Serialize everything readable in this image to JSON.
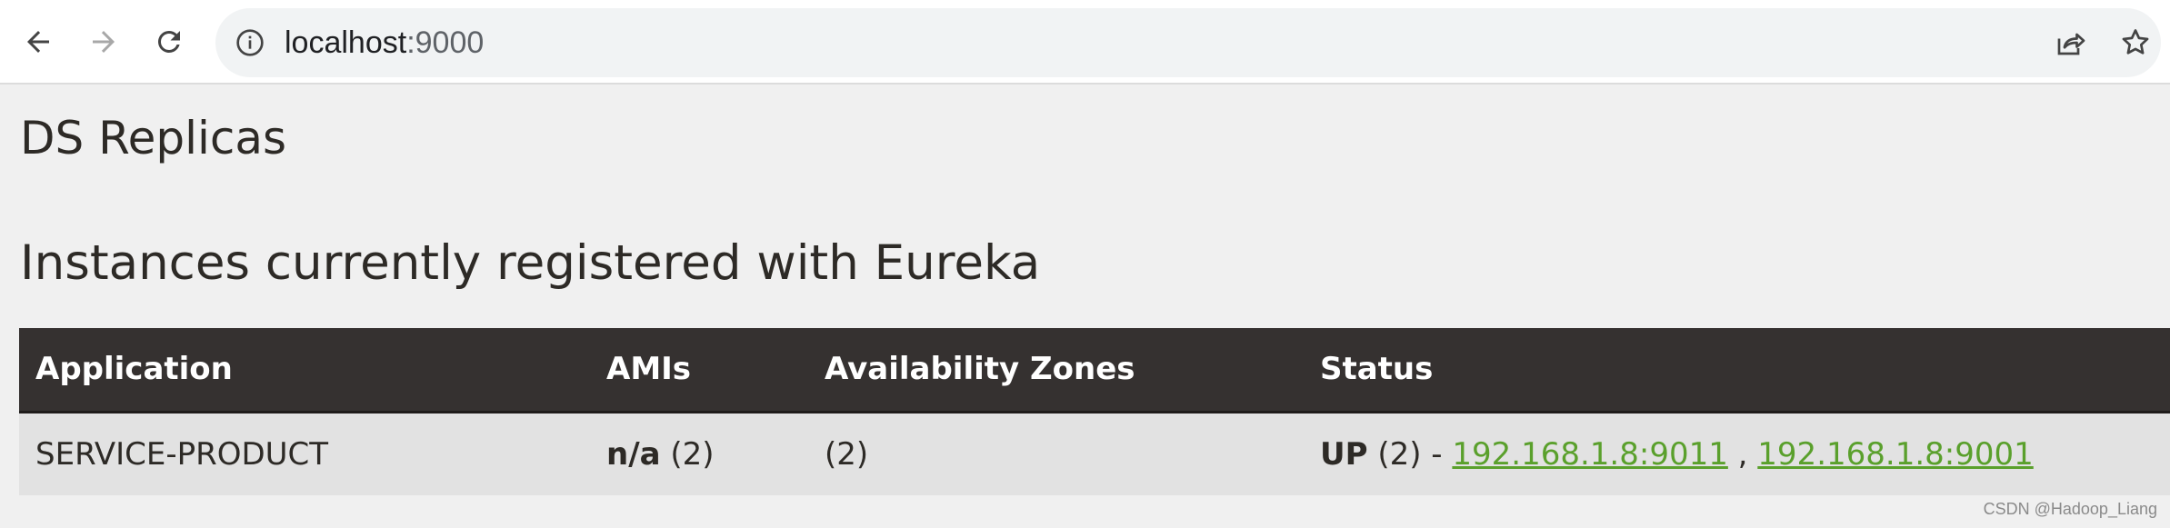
{
  "browser": {
    "url_host": "localhost",
    "url_port": ":9000"
  },
  "page": {
    "replicas_heading": "DS Replicas",
    "instances_heading": "Instances currently registered with Eureka"
  },
  "table": {
    "headers": [
      "Application",
      "AMIs",
      "Availability Zones",
      "Status"
    ],
    "rows": [
      {
        "application": "SERVICE-PRODUCT",
        "amis_value": "n/a",
        "amis_count": " (2)",
        "zones": "(2)",
        "status_prefix": "UP",
        "status_count": " (2) - ",
        "link1": "192.168.1.8:9011",
        "separator": " , ",
        "link2": "192.168.1.8:9001"
      }
    ]
  },
  "watermark": "CSDN @Hadoop_Liang",
  "colors": {
    "header_bg": "#353130",
    "row_bg": "#e2e2e2",
    "page_bg": "#f0f0f0",
    "link": "#5aa02c"
  }
}
